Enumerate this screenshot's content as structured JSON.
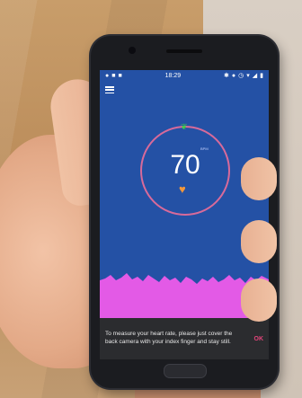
{
  "status_bar": {
    "time": "18:29"
  },
  "heart_rate": {
    "value": "70",
    "unit": "BPM"
  },
  "snackbar": {
    "message": "To measure your heart rate, please just cover the back camera with your index finger and stay still.",
    "action": "OK"
  },
  "colors": {
    "screen_background": "#2451a5",
    "wave_fill": "#e35ae6",
    "dial_ring": "#d86a9a",
    "heart": "#f4983a",
    "leaf": "#3fd04a",
    "ok_action": "#e2447a"
  },
  "icons": {
    "menu": "hamburger-icon",
    "status": [
      "whatsapp-icon",
      "message-icon",
      "bluetooth-icon",
      "dnd-icon",
      "alarm-icon",
      "wifi-icon",
      "signal-icon",
      "battery-icon"
    ],
    "top": "leaf-icon",
    "bottom": "heart-icon"
  }
}
